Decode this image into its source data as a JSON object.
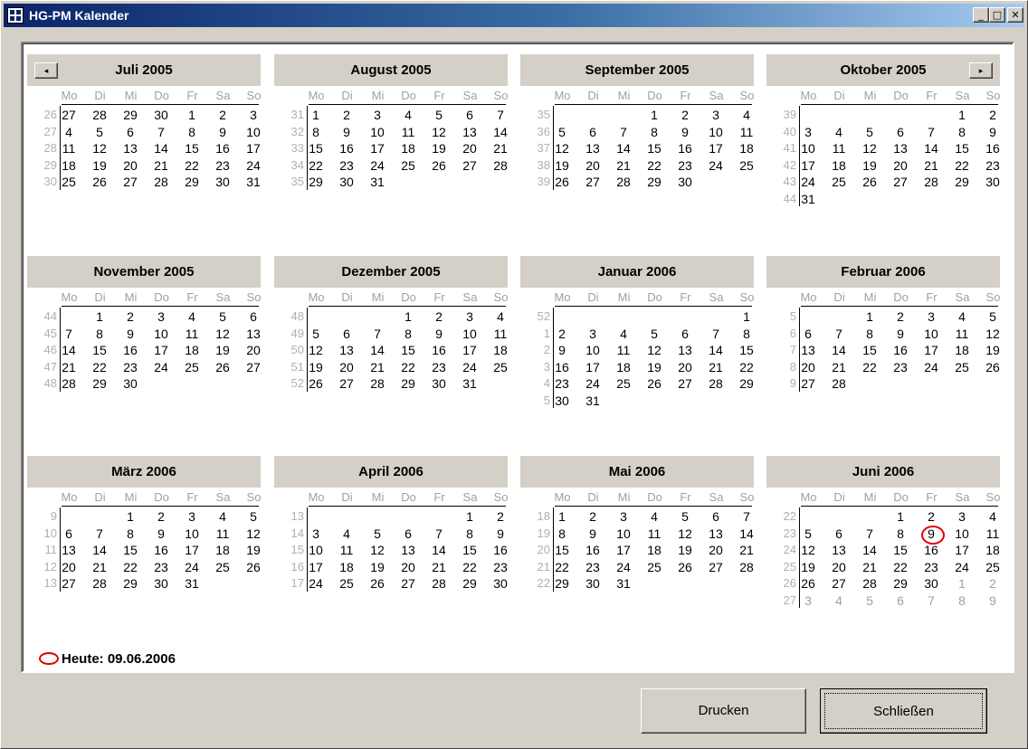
{
  "window": {
    "title": "HG-PM Kalender"
  },
  "titlebar_buttons": {
    "minimize": "_",
    "maximize": "□",
    "close": "✕"
  },
  "weekday_headers": [
    "Mo",
    "Di",
    "Mi",
    "Do",
    "Fr",
    "Sa",
    "So"
  ],
  "nav": {
    "prev": "◂",
    "next": "▸"
  },
  "months": [
    {
      "title": "Juli 2005",
      "weeks": [
        26,
        27,
        28,
        29,
        30
      ],
      "first_offset": 0,
      "days": [
        [
          27,
          28,
          29,
          30,
          1,
          2,
          3
        ],
        [
          4,
          5,
          6,
          7,
          8,
          9,
          10
        ],
        [
          11,
          12,
          13,
          14,
          15,
          16,
          17
        ],
        [
          18,
          19,
          20,
          21,
          22,
          23,
          24
        ],
        [
          25,
          26,
          27,
          28,
          29,
          30,
          31
        ]
      ]
    },
    {
      "title": "August 2005",
      "weeks": [
        31,
        32,
        33,
        34,
        35
      ],
      "days": [
        [
          1,
          2,
          3,
          4,
          5,
          6,
          7
        ],
        [
          8,
          9,
          10,
          11,
          12,
          13,
          14
        ],
        [
          15,
          16,
          17,
          18,
          19,
          20,
          21
        ],
        [
          22,
          23,
          24,
          25,
          26,
          27,
          28
        ],
        [
          29,
          30,
          31,
          "",
          "",
          "",
          ""
        ]
      ]
    },
    {
      "title": "September 2005",
      "weeks": [
        35,
        36,
        37,
        38,
        39
      ],
      "days": [
        [
          "",
          "",
          "",
          1,
          2,
          3,
          4
        ],
        [
          5,
          6,
          7,
          8,
          9,
          10,
          11
        ],
        [
          12,
          13,
          14,
          15,
          16,
          17,
          18
        ],
        [
          19,
          20,
          21,
          22,
          23,
          24,
          25
        ],
        [
          26,
          27,
          28,
          29,
          30,
          "",
          ""
        ]
      ]
    },
    {
      "title": "Oktober 2005",
      "weeks": [
        39,
        40,
        41,
        42,
        43,
        44
      ],
      "days": [
        [
          "",
          "",
          "",
          "",
          "",
          1,
          2
        ],
        [
          3,
          4,
          5,
          6,
          7,
          8,
          9
        ],
        [
          10,
          11,
          12,
          13,
          14,
          15,
          16
        ],
        [
          17,
          18,
          19,
          20,
          21,
          22,
          23
        ],
        [
          24,
          25,
          26,
          27,
          28,
          29,
          30
        ],
        [
          31,
          "",
          "",
          "",
          "",
          "",
          ""
        ]
      ]
    },
    {
      "title": "November 2005",
      "weeks": [
        44,
        45,
        46,
        47,
        48
      ],
      "days": [
        [
          "",
          1,
          2,
          3,
          4,
          5,
          6
        ],
        [
          7,
          8,
          9,
          10,
          11,
          12,
          13
        ],
        [
          14,
          15,
          16,
          17,
          18,
          19,
          20
        ],
        [
          21,
          22,
          23,
          24,
          25,
          26,
          27
        ],
        [
          28,
          29,
          30,
          "",
          "",
          "",
          ""
        ]
      ]
    },
    {
      "title": "Dezember 2005",
      "weeks": [
        48,
        49,
        50,
        51,
        52
      ],
      "days": [
        [
          "",
          "",
          "",
          1,
          2,
          3,
          4
        ],
        [
          5,
          6,
          7,
          8,
          9,
          10,
          11
        ],
        [
          12,
          13,
          14,
          15,
          16,
          17,
          18
        ],
        [
          19,
          20,
          21,
          22,
          23,
          24,
          25
        ],
        [
          26,
          27,
          28,
          29,
          30,
          31,
          ""
        ]
      ]
    },
    {
      "title": "Januar 2006",
      "weeks": [
        52,
        1,
        2,
        3,
        4,
        5
      ],
      "days": [
        [
          "",
          "",
          "",
          "",
          "",
          "",
          1
        ],
        [
          2,
          3,
          4,
          5,
          6,
          7,
          8
        ],
        [
          9,
          10,
          11,
          12,
          13,
          14,
          15
        ],
        [
          16,
          17,
          18,
          19,
          20,
          21,
          22
        ],
        [
          23,
          24,
          25,
          26,
          27,
          28,
          29
        ],
        [
          30,
          31,
          "",
          "",
          "",
          "",
          ""
        ]
      ]
    },
    {
      "title": "Februar 2006",
      "weeks": [
        5,
        6,
        7,
        8,
        9
      ],
      "days": [
        [
          "",
          "",
          1,
          2,
          3,
          4,
          5
        ],
        [
          6,
          7,
          8,
          9,
          10,
          11,
          12
        ],
        [
          13,
          14,
          15,
          16,
          17,
          18,
          19
        ],
        [
          20,
          21,
          22,
          23,
          24,
          25,
          26
        ],
        [
          27,
          28,
          "",
          "",
          "",
          "",
          ""
        ]
      ]
    },
    {
      "title": "März 2006",
      "weeks": [
        9,
        10,
        11,
        12,
        13
      ],
      "days": [
        [
          "",
          "",
          1,
          2,
          3,
          4,
          5
        ],
        [
          6,
          7,
          8,
          9,
          10,
          11,
          12
        ],
        [
          13,
          14,
          15,
          16,
          17,
          18,
          19
        ],
        [
          20,
          21,
          22,
          23,
          24,
          25,
          26
        ],
        [
          27,
          28,
          29,
          30,
          31,
          "",
          ""
        ]
      ]
    },
    {
      "title": "April 2006",
      "weeks": [
        13,
        14,
        15,
        16,
        17
      ],
      "days": [
        [
          "",
          "",
          "",
          "",
          "",
          1,
          2
        ],
        [
          3,
          4,
          5,
          6,
          7,
          8,
          9
        ],
        [
          10,
          11,
          12,
          13,
          14,
          15,
          16
        ],
        [
          17,
          18,
          19,
          20,
          21,
          22,
          23
        ],
        [
          24,
          25,
          26,
          27,
          28,
          29,
          30
        ]
      ]
    },
    {
      "title": "Mai 2006",
      "weeks": [
        18,
        19,
        20,
        21,
        22
      ],
      "days": [
        [
          1,
          2,
          3,
          4,
          5,
          6,
          7
        ],
        [
          8,
          9,
          10,
          11,
          12,
          13,
          14
        ],
        [
          15,
          16,
          17,
          18,
          19,
          20,
          21
        ],
        [
          22,
          23,
          24,
          25,
          26,
          27,
          28
        ],
        [
          29,
          30,
          31,
          "",
          "",
          "",
          ""
        ]
      ]
    },
    {
      "title": "Juni 2006",
      "weeks": [
        22,
        23,
        24,
        25,
        26,
        27
      ],
      "days": [
        [
          "",
          "",
          "",
          1,
          2,
          3,
          4
        ],
        [
          5,
          6,
          7,
          8,
          9,
          10,
          11
        ],
        [
          12,
          13,
          14,
          15,
          16,
          17,
          18
        ],
        [
          19,
          20,
          21,
          22,
          23,
          24,
          25
        ],
        [
          26,
          27,
          28,
          29,
          30,
          1,
          2
        ],
        [
          3,
          4,
          5,
          6,
          7,
          8,
          9
        ]
      ],
      "other_month_cells": [
        [
          4,
          5
        ],
        [
          4,
          6
        ],
        [
          5,
          0
        ],
        [
          5,
          1
        ],
        [
          5,
          2
        ],
        [
          5,
          3
        ],
        [
          5,
          4
        ],
        [
          5,
          5
        ],
        [
          5,
          6
        ]
      ],
      "today_cell": [
        1,
        4
      ]
    }
  ],
  "today": {
    "label": "Heute: 09.06.2006"
  },
  "buttons": {
    "print": "Drucken",
    "close": "Schließen"
  },
  "colors": {
    "today_marker": "#e00000",
    "title_gradient_start": "#0a246a",
    "title_gradient_end": "#a6caf0"
  }
}
